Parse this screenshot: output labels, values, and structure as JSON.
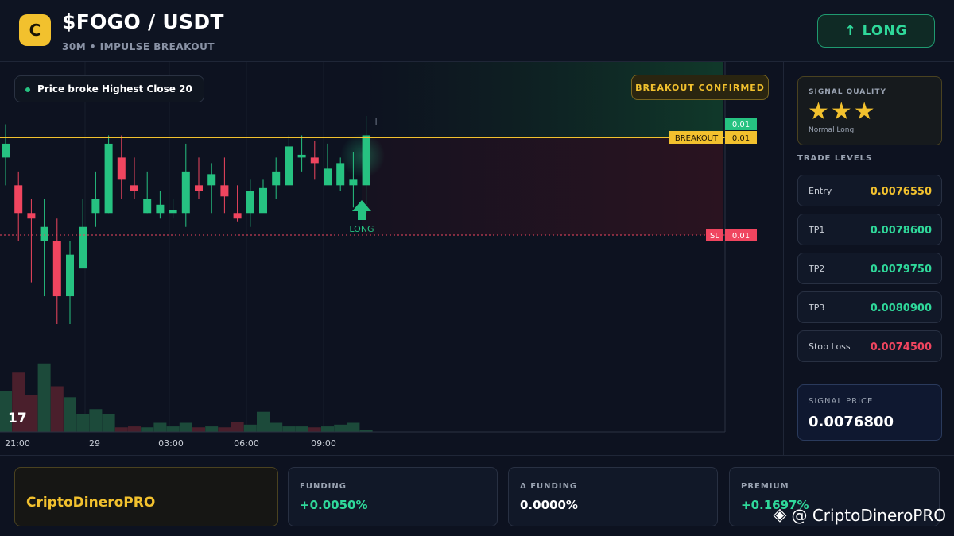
{
  "header": {
    "logo_letter": "C",
    "title": "$FOGO / USDT",
    "subtitle": "30M • IMPULSE BREAKOUT",
    "direction_button": "↑ LONG"
  },
  "chart": {
    "note": "Price broke Highest Close 20",
    "badge": "BREAKOUT CONFIRMED",
    "breakout_label": "BREAKOUT",
    "breakout_value": "0.01",
    "top_value": "0.01",
    "sl_label": "SL",
    "sl_value": "0.01",
    "signal_label": "LONG",
    "tv_logo": "17",
    "time_axis": [
      "21:00",
      "29",
      "03:00",
      "06:00",
      "09:00"
    ]
  },
  "chart_data": {
    "type": "candlestick",
    "candles": [
      {
        "o": 0.0076,
        "h": 0.00772,
        "l": 0.0075,
        "c": 0.00765
      },
      {
        "o": 0.0075,
        "h": 0.00755,
        "l": 0.0073,
        "c": 0.0074
      },
      {
        "o": 0.0074,
        "h": 0.00745,
        "l": 0.00715,
        "c": 0.00738
      },
      {
        "o": 0.0073,
        "h": 0.00745,
        "l": 0.0071,
        "c": 0.00735
      },
      {
        "o": 0.0073,
        "h": 0.00738,
        "l": 0.007,
        "c": 0.0071
      },
      {
        "o": 0.0071,
        "h": 0.0073,
        "l": 0.007,
        "c": 0.00725
      },
      {
        "o": 0.0072,
        "h": 0.00745,
        "l": 0.00725,
        "c": 0.00735
      },
      {
        "o": 0.0074,
        "h": 0.00755,
        "l": 0.00735,
        "c": 0.00745
      },
      {
        "o": 0.0074,
        "h": 0.00768,
        "l": 0.0074,
        "c": 0.00765
      },
      {
        "o": 0.0076,
        "h": 0.00768,
        "l": 0.00745,
        "c": 0.00752
      },
      {
        "o": 0.0075,
        "h": 0.0076,
        "l": 0.00745,
        "c": 0.00748
      },
      {
        "o": 0.0074,
        "h": 0.00755,
        "l": 0.0074,
        "c": 0.00745
      },
      {
        "o": 0.0074,
        "h": 0.00748,
        "l": 0.00738,
        "c": 0.00743
      },
      {
        "o": 0.0074,
        "h": 0.00745,
        "l": 0.00738,
        "c": 0.00741
      },
      {
        "o": 0.0074,
        "h": 0.00765,
        "l": 0.00735,
        "c": 0.00755
      },
      {
        "o": 0.0075,
        "h": 0.0076,
        "l": 0.00745,
        "c": 0.00748
      },
      {
        "o": 0.0075,
        "h": 0.00758,
        "l": 0.0074,
        "c": 0.00754
      },
      {
        "o": 0.0075,
        "h": 0.0076,
        "l": 0.0074,
        "c": 0.00746
      },
      {
        "o": 0.0074,
        "h": 0.0075,
        "l": 0.00737,
        "c": 0.00738
      },
      {
        "o": 0.0074,
        "h": 0.00752,
        "l": 0.00735,
        "c": 0.00748
      },
      {
        "o": 0.0074,
        "h": 0.00752,
        "l": 0.00742,
        "c": 0.00749
      },
      {
        "o": 0.0075,
        "h": 0.0076,
        "l": 0.00745,
        "c": 0.00755
      },
      {
        "o": 0.0075,
        "h": 0.00768,
        "l": 0.0075,
        "c": 0.00764
      },
      {
        "o": 0.0076,
        "h": 0.00768,
        "l": 0.00755,
        "c": 0.00761
      },
      {
        "o": 0.0076,
        "h": 0.00766,
        "l": 0.00752,
        "c": 0.00758
      },
      {
        "o": 0.0075,
        "h": 0.00765,
        "l": 0.00752,
        "c": 0.00756
      },
      {
        "o": 0.0075,
        "h": 0.0076,
        "l": 0.00748,
        "c": 0.00758
      },
      {
        "o": 0.0075,
        "h": 0.00762,
        "l": 0.00742,
        "c": 0.00752
      },
      {
        "o": 0.0075,
        "h": 0.00775,
        "l": 0.0074,
        "c": 0.00768
      }
    ],
    "volumes": [
      [
        0.45,
        0.45
      ],
      [
        0.65,
        0.65
      ],
      [
        0.4,
        0.4
      ],
      [
        0.75,
        0.75
      ],
      [
        0.5,
        0.5
      ],
      [
        0.38,
        0.38
      ],
      [
        0.2,
        0.2
      ],
      [
        0.25,
        0.25
      ],
      [
        0.2,
        0.2
      ],
      [
        0.05,
        0.05
      ],
      [
        0.06,
        0.06
      ],
      [
        0.05,
        0.05
      ],
      [
        0.1,
        0.1
      ],
      [
        0.06,
        0.06
      ],
      [
        0.1,
        0.1
      ],
      [
        0.05,
        0.05
      ],
      [
        0.06,
        0.06
      ],
      [
        0.05,
        0.05
      ],
      [
        0.11,
        0.11
      ],
      [
        0.08,
        0.08
      ],
      [
        0.22,
        0.22
      ],
      [
        0.1,
        0.1
      ],
      [
        0.06,
        0.06
      ],
      [
        0.06,
        0.06
      ],
      [
        0.05,
        0.05
      ],
      [
        0.06,
        0.06
      ],
      [
        0.08,
        0.08
      ],
      [
        0.1,
        0.1
      ],
      [
        0.02,
        0.02
      ]
    ]
  },
  "sidebar": {
    "signal_quality_label": "SIGNAL QUALITY",
    "stars": "★★★",
    "signal_type": "Normal Long",
    "trade_levels_label": "TRADE LEVELS",
    "levels": [
      {
        "name": "Entry",
        "value": "0.0076550",
        "color": "#f2c12e"
      },
      {
        "name": "TP1",
        "value": "0.0078600",
        "color": "#2fd89a"
      },
      {
        "name": "TP2",
        "value": "0.0079750",
        "color": "#2fd89a"
      },
      {
        "name": "TP3",
        "value": "0.0080900",
        "color": "#2fd89a"
      },
      {
        "name": "Stop Loss",
        "value": "0.0074500",
        "color": "#f0455f"
      }
    ],
    "signal_price_label": "SIGNAL PRICE",
    "signal_price": "0.0076800"
  },
  "footer": {
    "brand": "CriptoDineroPRO",
    "funding_label": "FUNDING",
    "funding_value": "+0.0050%",
    "dfunding_label": "Δ FUNDING",
    "dfunding_value": "0.0000%",
    "premium_label": "PREMIUM",
    "premium_value": "+0.1697%",
    "watermark": "@ CriptoDineroPRO"
  },
  "colors": {
    "up": "#26c281",
    "down": "#f0455f",
    "accent": "#f2c12e"
  }
}
